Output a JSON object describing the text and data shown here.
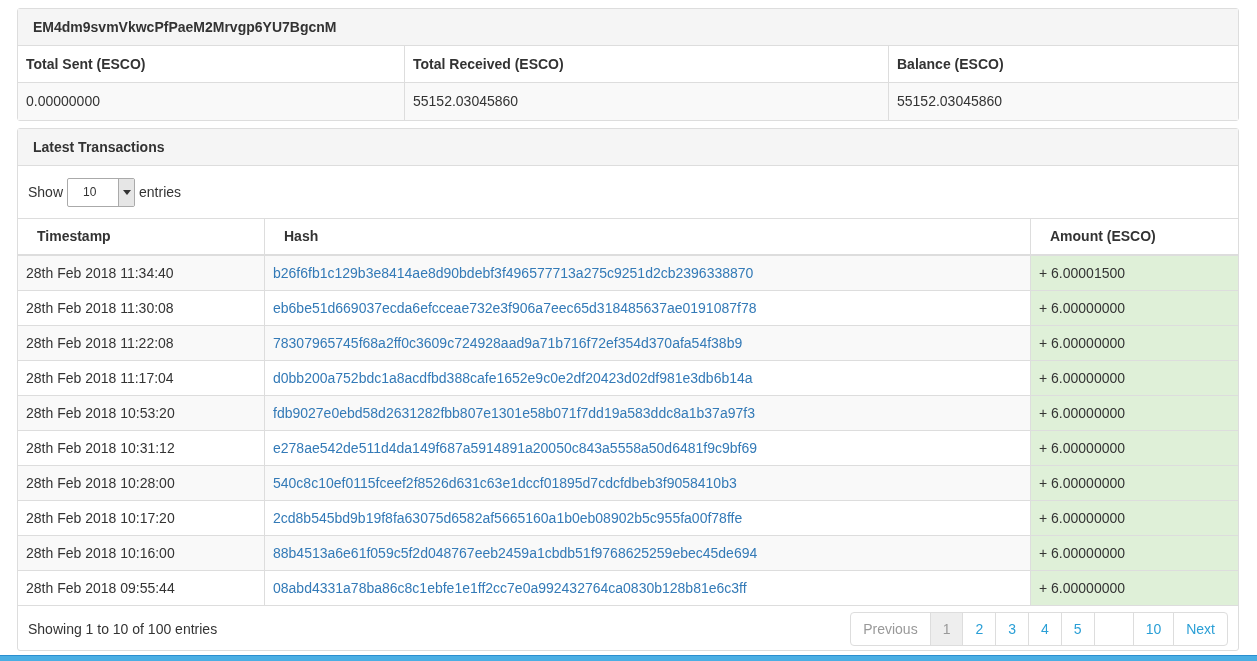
{
  "address_panel": {
    "title": "EM4dm9svmVkwcPfPaeM2Mrvgp6YU7BgcnM",
    "columns": [
      "Total Sent (ESCO)",
      "Total Received (ESCO)",
      "Balance (ESCO)"
    ],
    "values": [
      "0.00000000",
      "55152.03045860",
      "55152.03045860"
    ]
  },
  "transactions_panel": {
    "title": "Latest Transactions",
    "length_menu": {
      "prefix": "Show",
      "value": "10",
      "suffix": "entries"
    },
    "table": {
      "columns": [
        "Timestamp",
        "Hash",
        "Amount (ESCO)"
      ],
      "rows": [
        {
          "timestamp": "28th Feb 2018 11:34:40",
          "hash": "b26f6fb1c129b3e8414ae8d90bdebf3f496577713a275c9251d2cb2396338870",
          "amount": "+ 6.00001500"
        },
        {
          "timestamp": "28th Feb 2018 11:30:08",
          "hash": "eb6be51d669037ecda6efcceae732e3f906a7eec65d318485637ae0191087f78",
          "amount": "+ 6.00000000"
        },
        {
          "timestamp": "28th Feb 2018 11:22:08",
          "hash": "78307965745f68a2ff0c3609c724928aad9a71b716f72ef354d370afa54f38b9",
          "amount": "+ 6.00000000"
        },
        {
          "timestamp": "28th Feb 2018 11:17:04",
          "hash": "d0bb200a752bdc1a8acdfbd388cafe1652e9c0e2df20423d02df981e3db6b14a",
          "amount": "+ 6.00000000"
        },
        {
          "timestamp": "28th Feb 2018 10:53:20",
          "hash": "fdb9027e0ebd58d2631282fbb807e1301e58b071f7dd19a583ddc8a1b37a97f3",
          "amount": "+ 6.00000000"
        },
        {
          "timestamp": "28th Feb 2018 10:31:12",
          "hash": "e278ae542de511d4da149f687a5914891a20050c843a5558a50d6481f9c9bf69",
          "amount": "+ 6.00000000"
        },
        {
          "timestamp": "28th Feb 2018 10:28:00",
          "hash": "540c8c10ef0115fceef2f8526d631c63e1dccf01895d7cdcfdbeb3f9058410b3",
          "amount": "+ 6.00000000"
        },
        {
          "timestamp": "28th Feb 2018 10:17:20",
          "hash": "2cd8b545bd9b19f8fa63075d6582af5665160a1b0eb08902b5c955fa00f78ffe",
          "amount": "+ 6.00000000"
        },
        {
          "timestamp": "28th Feb 2018 10:16:00",
          "hash": "88b4513a6e61f059c5f2d048767eeb2459a1cbdb51f9768625259ebec45de694",
          "amount": "+ 6.00000000"
        },
        {
          "timestamp": "28th Feb 2018 09:55:44",
          "hash": "08abd4331a78ba86c8c1ebfe1e1ff2cc7e0a992432764ca0830b128b81e6c3ff",
          "amount": "+ 6.00000000"
        }
      ]
    },
    "info": "Showing 1 to 10 of 100 entries",
    "pagination": [
      {
        "label": "Previous",
        "kind": "nav",
        "disabled": true,
        "selected": false
      },
      {
        "label": "1",
        "kind": "page",
        "disabled": false,
        "selected": true
      },
      {
        "label": "2",
        "kind": "page",
        "disabled": false,
        "selected": false
      },
      {
        "label": "3",
        "kind": "page",
        "disabled": false,
        "selected": false
      },
      {
        "label": "4",
        "kind": "page",
        "disabled": false,
        "selected": false
      },
      {
        "label": "5",
        "kind": "page",
        "disabled": false,
        "selected": false
      },
      {
        "kind": "gap"
      },
      {
        "label": "10",
        "kind": "page",
        "disabled": false,
        "selected": false
      },
      {
        "label": "Next",
        "kind": "nav",
        "disabled": false,
        "selected": false
      }
    ]
  }
}
